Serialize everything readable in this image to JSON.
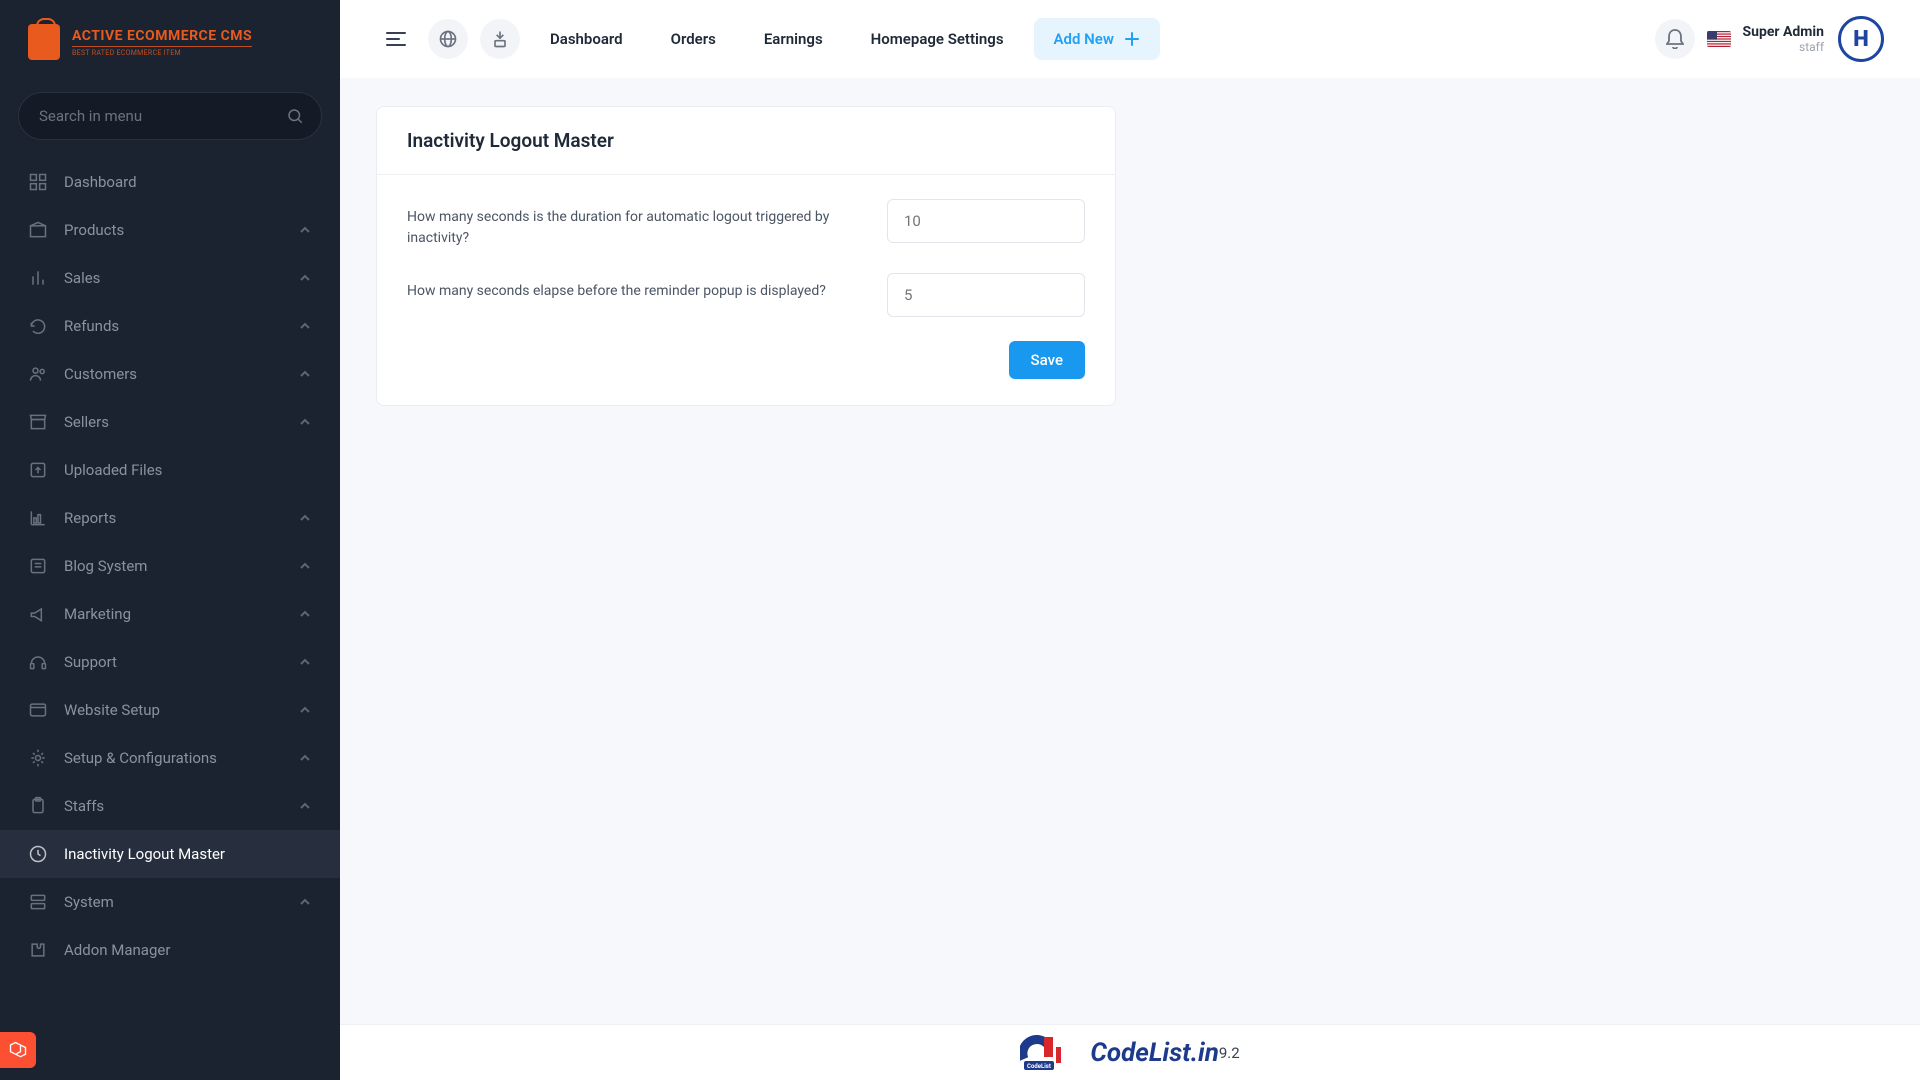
{
  "brand": {
    "title": "ACTIVE ECOMMERCE CMS",
    "subtitle": "BEST RATED ECOMMERCE ITEM"
  },
  "search": {
    "placeholder": "Search in menu"
  },
  "sidebar": {
    "items": [
      {
        "label": "Dashboard",
        "icon": "grid",
        "expandable": false,
        "active": false
      },
      {
        "label": "Products",
        "icon": "box",
        "expandable": true,
        "active": false
      },
      {
        "label": "Sales",
        "icon": "bars",
        "expandable": true,
        "active": false
      },
      {
        "label": "Refunds",
        "icon": "refresh",
        "expandable": true,
        "active": false
      },
      {
        "label": "Customers",
        "icon": "users",
        "expandable": true,
        "active": false
      },
      {
        "label": "Sellers",
        "icon": "store",
        "expandable": true,
        "active": false
      },
      {
        "label": "Uploaded Files",
        "icon": "upload",
        "expandable": false,
        "active": false
      },
      {
        "label": "Reports",
        "icon": "chart",
        "expandable": true,
        "active": false
      },
      {
        "label": "Blog System",
        "icon": "blog",
        "expandable": true,
        "active": false
      },
      {
        "label": "Marketing",
        "icon": "megaphone",
        "expandable": true,
        "active": false
      },
      {
        "label": "Support",
        "icon": "headset",
        "expandable": true,
        "active": false
      },
      {
        "label": "Website Setup",
        "icon": "window",
        "expandable": true,
        "active": false
      },
      {
        "label": "Setup & Configurations",
        "icon": "gear",
        "expandable": true,
        "active": false
      },
      {
        "label": "Staffs",
        "icon": "clipboard",
        "expandable": true,
        "active": false
      },
      {
        "label": "Inactivity Logout Master",
        "icon": "clock",
        "expandable": false,
        "active": true
      },
      {
        "label": "System",
        "icon": "server",
        "expandable": true,
        "active": false
      },
      {
        "label": "Addon Manager",
        "icon": "puzzle",
        "expandable": false,
        "active": false
      }
    ]
  },
  "topbar": {
    "links": [
      "Dashboard",
      "Orders",
      "Earnings",
      "Homepage Settings"
    ],
    "add_new": "Add New",
    "user": {
      "name": "Super Admin",
      "role": "staff",
      "initial": "H"
    }
  },
  "card": {
    "title": "Inactivity Logout Master",
    "field1_label": "How many seconds is the duration for automatic logout triggered by inactivity?",
    "field1_placeholder": "10",
    "field2_label": "How many seconds elapse before the reminder popup is displayed?",
    "field2_placeholder": "5",
    "save": "Save"
  },
  "footer": {
    "logo": "CodeList.in",
    "version": "9.2"
  }
}
